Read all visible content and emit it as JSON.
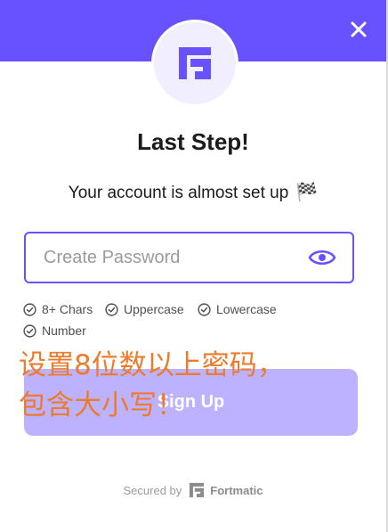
{
  "modal": {
    "title": "Last Step!",
    "subtitle": "Your account is almost set up",
    "subtitle_emoji": "🏁",
    "close_icon": "close-icon",
    "logo_icon": "fortmatic-logo-icon"
  },
  "password": {
    "placeholder": "Create Password",
    "value": "",
    "toggle_icon": "eye-icon"
  },
  "requirements": [
    {
      "label": "8+ Chars",
      "icon": "check-circle-icon"
    },
    {
      "label": "Uppercase",
      "icon": "check-circle-icon"
    },
    {
      "label": "Lowercase",
      "icon": "check-circle-icon"
    },
    {
      "label": "Number",
      "icon": "check-circle-icon"
    }
  ],
  "signup": {
    "label": "Sign Up"
  },
  "annotation": {
    "line1": "设置8位数以上密码，",
    "line2": "包含大小写！"
  },
  "footer": {
    "secured_by": "Secured by",
    "brand": "Fortmatic"
  },
  "colors": {
    "accent": "#6851ff",
    "button_disabled": "#bcb2ff",
    "annotation": "#ee7b2b",
    "text_dark": "#1b1b1f"
  }
}
